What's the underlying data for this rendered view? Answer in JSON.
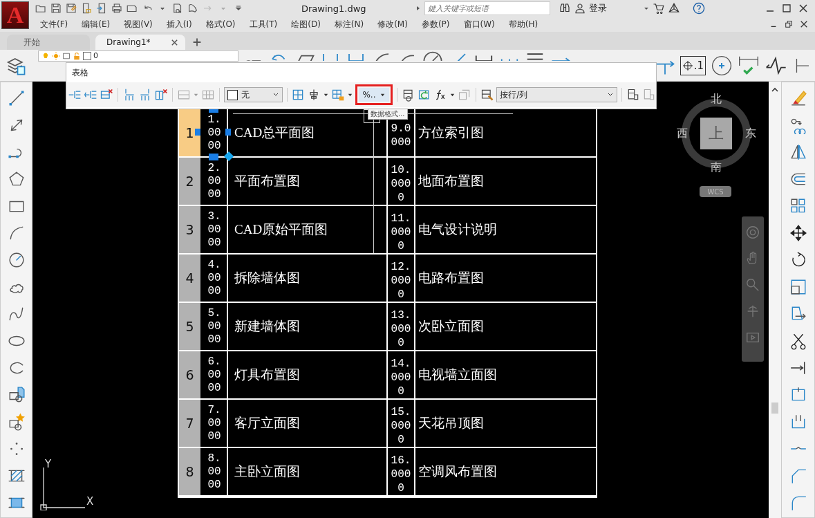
{
  "app": {
    "logo": "A",
    "title": "Drawing1.dwg",
    "search": {
      "placeholder": "鍵入关键字或短语"
    },
    "login": "登录"
  },
  "menu": [
    "文件(F)",
    "编辑(E)",
    "视图(V)",
    "插入(I)",
    "格式(O)",
    "工具(T)",
    "绘图(D)",
    "标注(N)",
    "修改(M)",
    "参数(P)",
    "窗口(W)",
    "帮助(H)"
  ],
  "tabs": [
    {
      "label": "开始",
      "selected": false
    },
    {
      "label": "Drawing1*",
      "selected": true
    }
  ],
  "layer_toolbar": {
    "layer": "0",
    "tolerance_label": ".1"
  },
  "table_toolbar": {
    "title": "表格",
    "cell_style": "无",
    "data_format": {
      "label": "%..",
      "highlighted": true
    },
    "link_mode": "按行/列",
    "tooltip": "数据格式..."
  },
  "drawing_table": {
    "rows": [
      {
        "header": "1",
        "selected": true,
        "cells": [
          "1.0000",
          "CAD总平面图",
          "9.0000",
          "方位索引图"
        ]
      },
      {
        "header": "2",
        "selected": false,
        "cells": [
          "2.0000",
          "平面布置图",
          "10.0000",
          "地面布置图"
        ]
      },
      {
        "header": "3",
        "selected": false,
        "cells": [
          "3.0000",
          "CAD原始平面图",
          "11.0000",
          "电气设计说明"
        ]
      },
      {
        "header": "4",
        "selected": false,
        "cells": [
          "4.0000",
          "拆除墙体图",
          "12.0000",
          "电路布置图"
        ]
      },
      {
        "header": "5",
        "selected": false,
        "cells": [
          "5.0000",
          "新建墙体图",
          "13.0000",
          "次卧立面图"
        ]
      },
      {
        "header": "6",
        "selected": false,
        "cells": [
          "6.0000",
          "灯具布置图",
          "14.0000",
          "电视墙立面图"
        ]
      },
      {
        "header": "7",
        "selected": false,
        "cells": [
          "7.0000",
          "客厅立面图",
          "15.0000",
          "天花吊顶图"
        ]
      },
      {
        "header": "8",
        "selected": false,
        "cells": [
          "8.0000",
          "主卧立面图",
          "16.0000",
          "空调风布置图"
        ]
      }
    ]
  },
  "viewcube": {
    "north": "北",
    "west": "西",
    "east": "东",
    "south": "南",
    "face": "上",
    "coordinate_system": "WCS"
  },
  "ucs": {
    "y": "Y",
    "x": "X"
  }
}
